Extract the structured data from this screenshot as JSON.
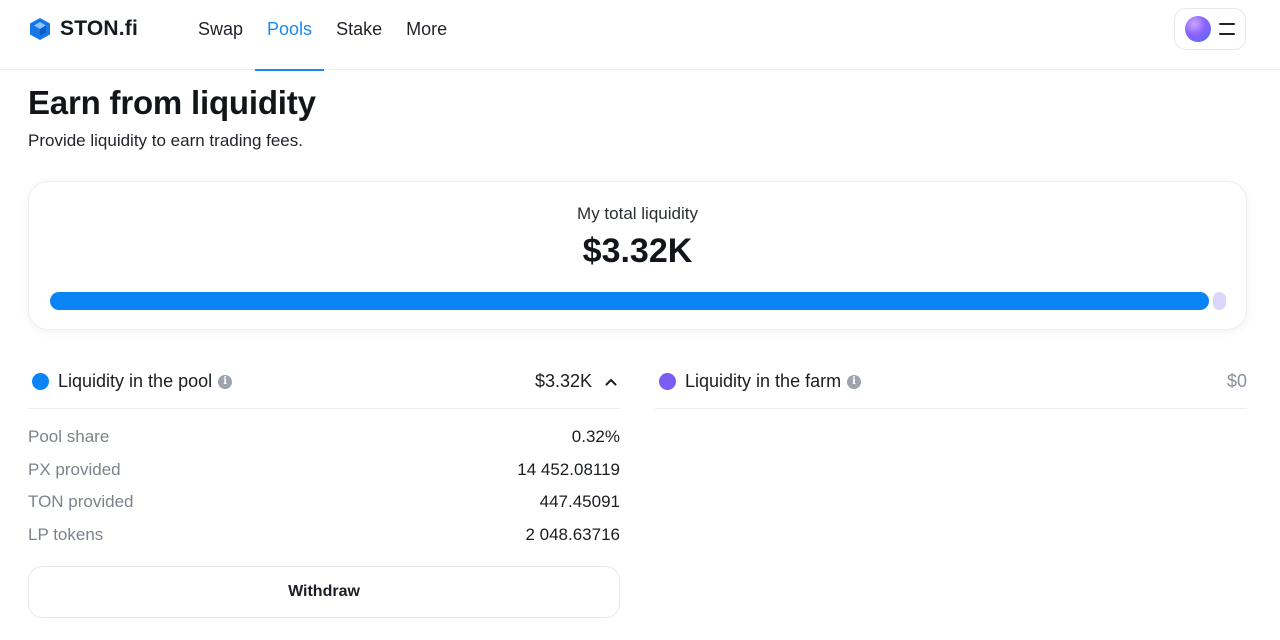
{
  "header": {
    "logo_text": "STON.fi",
    "nav": [
      {
        "label": "Swap",
        "active": false
      },
      {
        "label": "Pools",
        "active": true
      },
      {
        "label": "Stake",
        "active": false
      },
      {
        "label": "More",
        "active": false
      }
    ],
    "icons": {
      "logo": "ston-logo-icon",
      "avatar": "avatar",
      "menu": "menu-icon"
    }
  },
  "page": {
    "title": "Earn from liquidity",
    "subtitle": "Provide liquidity to earn trading fees."
  },
  "total": {
    "label": "My total liquidity",
    "value": "$3.32K",
    "pool_share_of_bar": 0.99,
    "farm_share_of_bar": 0.01
  },
  "pool": {
    "title": "Liquidity in the pool",
    "value": "$3.32K",
    "expanded": true,
    "dot_color": "#0a84f5",
    "rows": [
      {
        "label": "Pool share",
        "value": "0.32%"
      },
      {
        "label": "PX provided",
        "value": "14 452.08119"
      },
      {
        "label": "TON provided",
        "value": "447.45091"
      },
      {
        "label": "LP tokens",
        "value": "2 048.63716"
      }
    ],
    "withdraw_label": "Withdraw"
  },
  "farm": {
    "title": "Liquidity in the farm",
    "value": "$0",
    "dot_color": "#7b5cf5"
  },
  "colors": {
    "accent": "#1a8af0",
    "pool_bar": "#0a84f5",
    "farm_bar": "#dcd6fb"
  }
}
